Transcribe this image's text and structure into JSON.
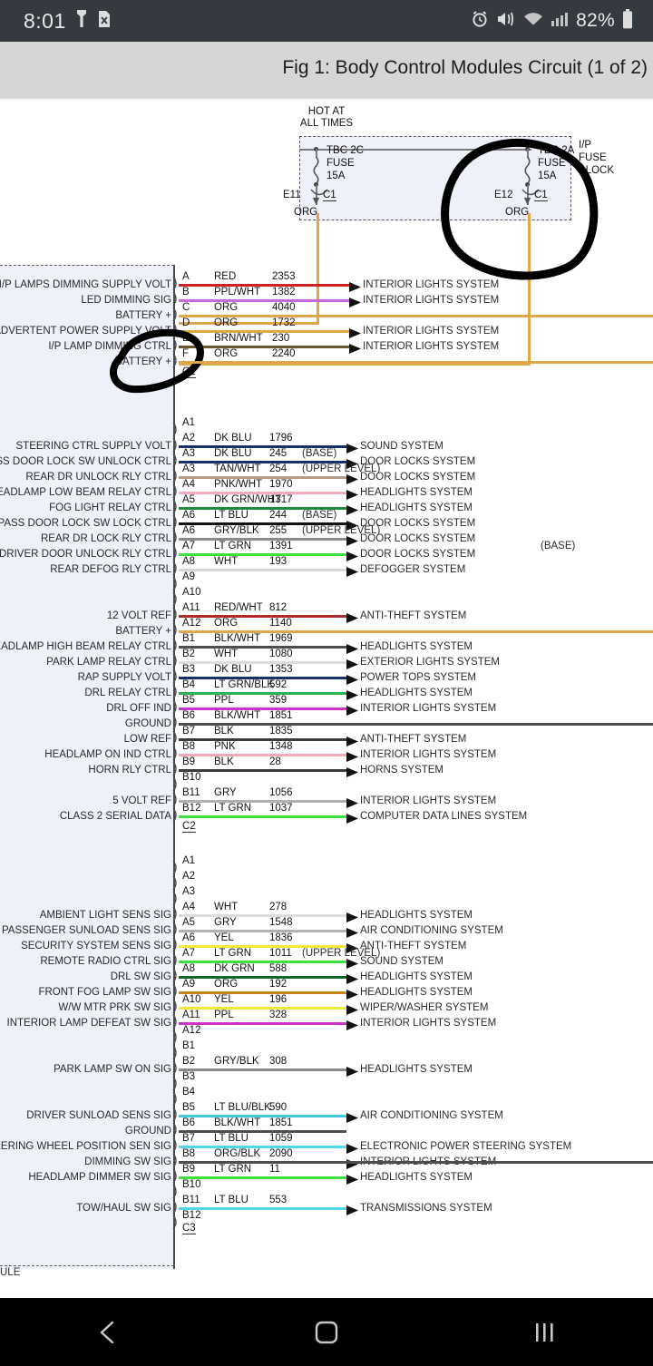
{
  "statusbar": {
    "clock": "8:01",
    "battery_pct": "82%",
    "icons": [
      "flashlight-icon",
      "sim-card-error-icon",
      "alarm-icon",
      "vibrate-mute-icon",
      "wifi-icon",
      "cellular-signal-icon",
      "battery-icon"
    ]
  },
  "titlebar": {
    "title": "Fig 1: Body Control Modules Circuit (1 of 2)"
  },
  "diagram": {
    "hot_at_line1": "HOT AT",
    "hot_at_line2": "ALL TIMES",
    "ip_fuse_block": "I/P\nFUSE\nBLOCK",
    "ip_fuse_block_l1": "I/P",
    "ip_fuse_block_l2": "FUSE",
    "ip_fuse_block_l3": "BLOCK",
    "bottom_partial_label": "ULE",
    "fuses": [
      {
        "name": "TBC 2C",
        "fuse_word": "FUSE",
        "rating": "15A",
        "pin": "E11",
        "conn": "C1",
        "wire_color": "ORG"
      },
      {
        "name": "TBC 2A",
        "fuse_word": "FUSE",
        "rating": "15A",
        "pin": "E12",
        "conn": "C1",
        "wire_color": "ORG"
      }
    ],
    "annotations": [
      {
        "name": "hand-circle-tbc2a",
        "note": "hand-drawn black ellipse around TBC 2A fuse"
      },
      {
        "name": "hand-circle-battery-plus",
        "note": "hand-drawn black ellipse around BATTERY + / F pin"
      }
    ],
    "connectors": [
      {
        "id": "C1",
        "tag": "C1",
        "rows": [
          {
            "pin": "A",
            "wire": "RED",
            "circuit": "2353",
            "label": "I/P LAMPS DIMMING SUPPLY VOLT",
            "dest": "INTERIOR LIGHTS SYSTEM",
            "note": "",
            "color": "#cc2222"
          },
          {
            "pin": "B",
            "wire": "PPL/WHT",
            "circuit": "1382",
            "label": "LED DIMMING SIG",
            "dest": "INTERIOR LIGHTS SYSTEM",
            "note": "",
            "color": "#cc66dd"
          },
          {
            "pin": "C",
            "wire": "ORG",
            "circuit": "4040",
            "label": "BATTERY +",
            "dest": "",
            "note": "",
            "color": "#e0a64a"
          },
          {
            "pin": "D",
            "wire": "ORG",
            "circuit": "1732",
            "label": "INADVERTENT POWER SUPPLY VOLT",
            "dest": "INTERIOR LIGHTS SYSTEM",
            "note": "",
            "color": "#e0a64a"
          },
          {
            "pin": "E",
            "wire": "BRN/WHT",
            "circuit": "230",
            "label": "I/P LAMP DIMMING CTRL",
            "dest": "INTERIOR LIGHTS SYSTEM",
            "note": "",
            "color": "#6b5632"
          },
          {
            "pin": "F",
            "wire": "ORG",
            "circuit": "2240",
            "label": "BATTERY +",
            "dest": "",
            "note": "",
            "color": "#e0a64a"
          }
        ]
      },
      {
        "id": "C2",
        "tag": "C2",
        "rows": [
          {
            "pin": "A1",
            "wire": "",
            "circuit": "",
            "label": "",
            "dest": "",
            "note": "",
            "color": ""
          },
          {
            "pin": "A2",
            "wire": "DK BLU",
            "circuit": "1796",
            "label": "STEERING CTRL SUPPLY VOLT",
            "dest": "SOUND SYSTEM",
            "note": "",
            "color": "#16306b"
          },
          {
            "pin": "A3",
            "wire": "DK BLU",
            "circuit": "245",
            "label": "PASS DOOR LOCK SW UNLOCK CTRL",
            "dest": "DOOR LOCKS SYSTEM",
            "note": "(BASE)",
            "color": "#16306b"
          },
          {
            "pin": "A3",
            "wire": "TAN/WHT",
            "circuit": "254",
            "label": "REAR DR UNLOCK RLY CTRL",
            "dest": "DOOR LOCKS SYSTEM",
            "note": "(UPPER LEVEL)",
            "color": "#b59b86"
          },
          {
            "pin": "A4",
            "wire": "PNK/WHT",
            "circuit": "1970",
            "label": "HEADLAMP LOW BEAM RELAY CTRL",
            "dest": "HEADLIGHTS SYSTEM",
            "note": "",
            "color": "#f3aebd"
          },
          {
            "pin": "A5",
            "wire": "DK GRN/WHT",
            "circuit": "1317",
            "label": "FOG LIGHT RELAY CTRL",
            "dest": "HEADLIGHTS SYSTEM",
            "note": "",
            "color": "#1e8a3c"
          },
          {
            "pin": "A6",
            "wire": "LT BLU",
            "circuit": "244",
            "label": "PASS DOOR LOCK SW LOCK CTRL",
            "dest": "DOOR LOCKS SYSTEM",
            "note": "(BASE)",
            "color": "#111111"
          },
          {
            "pin": "A6",
            "wire": "GRY/BLK",
            "circuit": "255",
            "label": "REAR DR LOCK RLY CTRL",
            "dest": "DOOR LOCKS SYSTEM",
            "note": "(UPPER LEVEL)",
            "color": "#8a8a8a"
          },
          {
            "pin": "A7",
            "wire": "LT GRN",
            "circuit": "1391",
            "label": "DRIVER DOOR UNLOCK RLY CTRL",
            "dest": "DOOR LOCKS SYSTEM",
            "note": "(BASE)",
            "color": "#3ee03e"
          },
          {
            "pin": "A8",
            "wire": "WHT",
            "circuit": "193",
            "label": "REAR DEFOG RLY CTRL",
            "dest": "DEFOGGER SYSTEM",
            "note": "",
            "color": "#d8d8d8"
          },
          {
            "pin": "A9",
            "wire": "",
            "circuit": "",
            "label": "",
            "dest": "",
            "note": "",
            "color": ""
          },
          {
            "pin": "A10",
            "wire": "",
            "circuit": "",
            "label": "",
            "dest": "",
            "note": "",
            "color": ""
          },
          {
            "pin": "A11",
            "wire": "RED/WHT",
            "circuit": "812",
            "label": "12 VOLT REF",
            "dest": "ANTI-THEFT SYSTEM",
            "note": "",
            "color": "#b02b2b"
          },
          {
            "pin": "A12",
            "wire": "ORG",
            "circuit": "1140",
            "label": "BATTERY +",
            "dest": "",
            "note": "",
            "color": "#e0a64a"
          },
          {
            "pin": "B1",
            "wire": "BLK/WHT",
            "circuit": "1969",
            "label": "HEADLAMP HIGH BEAM RELAY CTRL",
            "dest": "HEADLIGHTS SYSTEM",
            "note": "",
            "color": "#4d4d4d"
          },
          {
            "pin": "B2",
            "wire": "WHT",
            "circuit": "1080",
            "label": "PARK LAMP RELAY CTRL",
            "dest": "EXTERIOR LIGHTS SYSTEM",
            "note": "",
            "color": "#dcdcdc"
          },
          {
            "pin": "B3",
            "wire": "DK BLU",
            "circuit": "1353",
            "label": "RAP SUPPLY VOLT",
            "dest": "POWER TOPS SYSTEM",
            "note": "",
            "color": "#16306b"
          },
          {
            "pin": "B4",
            "wire": "LT GRN/BLK",
            "circuit": "592",
            "label": "DRL RELAY CTRL",
            "dest": "HEADLIGHTS SYSTEM",
            "note": "",
            "color": "#2eb053"
          },
          {
            "pin": "B5",
            "wire": "PPL",
            "circuit": "359",
            "label": "DRL OFF IND",
            "dest": "INTERIOR LIGHTS SYSTEM",
            "note": "",
            "color": "#cc33cc"
          },
          {
            "pin": "B6",
            "wire": "BLK/WHT",
            "circuit": "1851",
            "label": "GROUND",
            "dest": "",
            "note": "",
            "color": "#4d4d4d"
          },
          {
            "pin": "B7",
            "wire": "BLK",
            "circuit": "1835",
            "label": "LOW REF",
            "dest": "ANTI-THEFT SYSTEM",
            "note": "",
            "color": "#3a3a3a"
          },
          {
            "pin": "B8",
            "wire": "PNK",
            "circuit": "1348",
            "label": "HEADLAMP ON IND CTRL",
            "dest": "INTERIOR LIGHTS SYSTEM",
            "note": "",
            "color": "#f0aab6"
          },
          {
            "pin": "B9",
            "wire": "BLK",
            "circuit": "28",
            "label": "HORN RLY CTRL",
            "dest": "HORNS SYSTEM",
            "note": "",
            "color": "#3a3a3a"
          },
          {
            "pin": "B10",
            "wire": "",
            "circuit": "",
            "label": "",
            "dest": "",
            "note": "",
            "color": ""
          },
          {
            "pin": "B11",
            "wire": "GRY",
            "circuit": "1056",
            "label": "5 VOLT REF",
            "dest": "INTERIOR LIGHTS SYSTEM",
            "note": "",
            "color": "#b0b0b0"
          },
          {
            "pin": "B12",
            "wire": "LT GRN",
            "circuit": "1037",
            "label": "CLASS 2 SERIAL DATA",
            "dest": "COMPUTER DATA LINES SYSTEM",
            "note": "",
            "color": "#3ee03e"
          }
        ]
      },
      {
        "id": "C3",
        "tag": "C3",
        "rows": [
          {
            "pin": "A1",
            "wire": "",
            "circuit": "",
            "label": "",
            "dest": "",
            "note": "",
            "color": ""
          },
          {
            "pin": "A2",
            "wire": "",
            "circuit": "",
            "label": "",
            "dest": "",
            "note": "",
            "color": ""
          },
          {
            "pin": "A3",
            "wire": "",
            "circuit": "",
            "label": "",
            "dest": "",
            "note": "",
            "color": ""
          },
          {
            "pin": "A4",
            "wire": "WHT",
            "circuit": "278",
            "label": "AMBIENT LIGHT SENS SIG",
            "dest": "HEADLIGHTS SYSTEM",
            "note": "",
            "color": "#dcdcdc"
          },
          {
            "pin": "A5",
            "wire": "GRY",
            "circuit": "1548",
            "label": "PASSENGER SUNLOAD SENS SIG",
            "dest": "AIR CONDITIONING SYSTEM",
            "note": "",
            "color": "#b0b0b0"
          },
          {
            "pin": "A6",
            "wire": "YEL",
            "circuit": "1836",
            "label": "SECURITY SYSTEM SENS SIG",
            "dest": "ANTI-THEFT SYSTEM",
            "note": "",
            "color": "#f2e838"
          },
          {
            "pin": "A7",
            "wire": "LT GRN",
            "circuit": "1011",
            "label": "REMOTE RADIO CTRL SIG",
            "dest": "SOUND SYSTEM",
            "note": "(UPPER LEVEL)",
            "color": "#3ee03e"
          },
          {
            "pin": "A8",
            "wire": "DK GRN",
            "circuit": "588",
            "label": "DRL SW SIG",
            "dest": "HEADLIGHTS SYSTEM",
            "note": "",
            "color": "#13662c"
          },
          {
            "pin": "A9",
            "wire": "ORG",
            "circuit": "192",
            "label": "FRONT FOG LAMP SW SIG",
            "dest": "HEADLIGHTS SYSTEM",
            "note": "",
            "color": "#c8861b"
          },
          {
            "pin": "A10",
            "wire": "YEL",
            "circuit": "196",
            "label": "W/W MTR PRK SW SIG",
            "dest": "WIPER/WASHER SYSTEM",
            "note": "",
            "color": "#f2e838"
          },
          {
            "pin": "A11",
            "wire": "PPL",
            "circuit": "328",
            "label": "INTERIOR LAMP DEFEAT SW SIG",
            "dest": "INTERIOR LIGHTS SYSTEM",
            "note": "",
            "color": "#cc33cc"
          },
          {
            "pin": "A12",
            "wire": "",
            "circuit": "",
            "label": "",
            "dest": "",
            "note": "",
            "color": ""
          },
          {
            "pin": "B1",
            "wire": "",
            "circuit": "",
            "label": "",
            "dest": "",
            "note": "",
            "color": ""
          },
          {
            "pin": "B2",
            "wire": "GRY/BLK",
            "circuit": "308",
            "label": "PARK LAMP SW ON SIG",
            "dest": "HEADLIGHTS SYSTEM",
            "note": "",
            "color": "#8a8a8a"
          },
          {
            "pin": "B3",
            "wire": "",
            "circuit": "",
            "label": "",
            "dest": "",
            "note": "",
            "color": ""
          },
          {
            "pin": "B4",
            "wire": "",
            "circuit": "",
            "label": "",
            "dest": "",
            "note": "",
            "color": ""
          },
          {
            "pin": "B5",
            "wire": "LT BLU/BLK",
            "circuit": "590",
            "label": "DRIVER SUNLOAD SENS SIG",
            "dest": "AIR CONDITIONING SYSTEM",
            "note": "",
            "color": "#3ec8d8"
          },
          {
            "pin": "B6",
            "wire": "BLK/WHT",
            "circuit": "1851",
            "label": "GROUND",
            "dest": "",
            "note": "",
            "color": "#4d4d4d"
          },
          {
            "pin": "B7",
            "wire": "LT BLU",
            "circuit": "1059",
            "label": "STEERING WHEEL POSITION SEN SIG",
            "dest": "ELECTRONIC POWER STEERING SYSTEM",
            "note": "",
            "color": "#4fd8e8"
          },
          {
            "pin": "B8",
            "wire": "ORG/BLK",
            "circuit": "2090",
            "label": "DIMMING SW SIG",
            "dest": "INTERIOR LIGHTS SYSTEM",
            "note": "",
            "color": "#9c6b33"
          },
          {
            "pin": "B9",
            "wire": "LT GRN",
            "circuit": "11",
            "label": "HEADLAMP DIMMER SW SIG",
            "dest": "HEADLIGHTS SYSTEM",
            "note": "",
            "color": "#3ee03e"
          },
          {
            "pin": "B10",
            "wire": "",
            "circuit": "",
            "label": "",
            "dest": "",
            "note": "",
            "color": ""
          },
          {
            "pin": "B11",
            "wire": "LT BLU",
            "circuit": "553",
            "label": "TOW/HAUL SW SIG",
            "dest": "TRANSMISSIONS SYSTEM",
            "note": "",
            "color": "#4fd8e8"
          },
          {
            "pin": "B12",
            "wire": "",
            "circuit": "",
            "label": "",
            "dest": "",
            "note": "",
            "color": ""
          }
        ]
      }
    ]
  },
  "navbar": {
    "back_label": "back-button",
    "home_label": "home-button",
    "recents_label": "recents-button"
  }
}
